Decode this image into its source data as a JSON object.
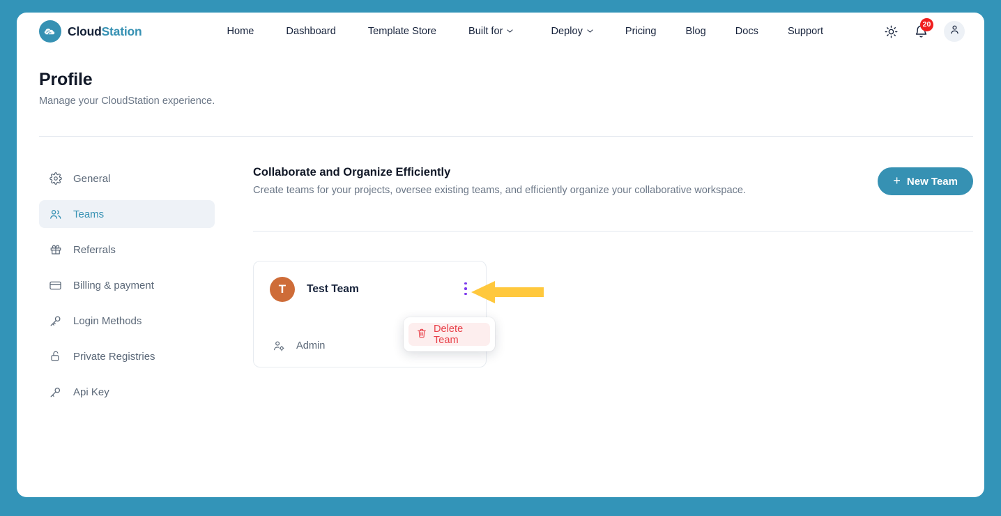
{
  "theme": {
    "background": "#3394b8",
    "accent": "#3691b3",
    "danger": "#e8414a",
    "badge": "#f01f1f",
    "avatar": "#ce6c38",
    "kebab": "#7c3aed",
    "annotation": "#ffc83d"
  },
  "navbar": {
    "brand": {
      "part1": "Cloud",
      "part2": "Station",
      "logo_icon": "cloud-icon"
    },
    "links": [
      {
        "label": "Home",
        "has_caret": false
      },
      {
        "label": "Dashboard",
        "has_caret": false
      },
      {
        "label": "Template Store",
        "has_caret": false
      },
      {
        "label": "Built for",
        "has_caret": true
      },
      {
        "label": "Deploy",
        "has_caret": true
      },
      {
        "label": "Pricing",
        "has_caret": false
      },
      {
        "label": "Blog",
        "has_caret": false
      },
      {
        "label": "Docs",
        "has_caret": false
      },
      {
        "label": "Support",
        "has_caret": false
      }
    ],
    "theme_toggle_icon": "sun-icon",
    "notifications_icon": "bell-icon",
    "notifications_count": "20",
    "account_icon": "user-icon"
  },
  "header": {
    "title": "Profile",
    "subtitle": "Manage your CloudStation experience."
  },
  "sidebar": {
    "items": [
      {
        "label": "General",
        "icon": "gear-icon",
        "active": false
      },
      {
        "label": "Teams",
        "icon": "users-icon",
        "active": true
      },
      {
        "label": "Referrals",
        "icon": "gift-icon",
        "active": false
      },
      {
        "label": "Billing & payment",
        "icon": "credit-card-icon",
        "active": false
      },
      {
        "label": "Login Methods",
        "icon": "key-icon",
        "active": false
      },
      {
        "label": "Private Registries",
        "icon": "unlock-icon",
        "active": false
      },
      {
        "label": "Api Key",
        "icon": "key-icon",
        "active": false
      }
    ]
  },
  "content": {
    "title": "Collaborate and Organize Efficiently",
    "subtitle": "Create teams for your projects, oversee existing teams, and efficiently organize your collaborative workspace.",
    "new_team_button": "New Team",
    "new_team_icon": "plus-icon"
  },
  "team_card": {
    "avatar_initial": "T",
    "name": "Test Team",
    "menu_icon": "kebab-menu-icon",
    "role_icon": "user-gear-icon",
    "role": "Admin"
  },
  "popover": {
    "delete_label": "Delete Team",
    "delete_icon": "trash-icon"
  },
  "annotation": {
    "icon": "left-arrow-pointer",
    "points_at": "kebab-menu-icon"
  }
}
